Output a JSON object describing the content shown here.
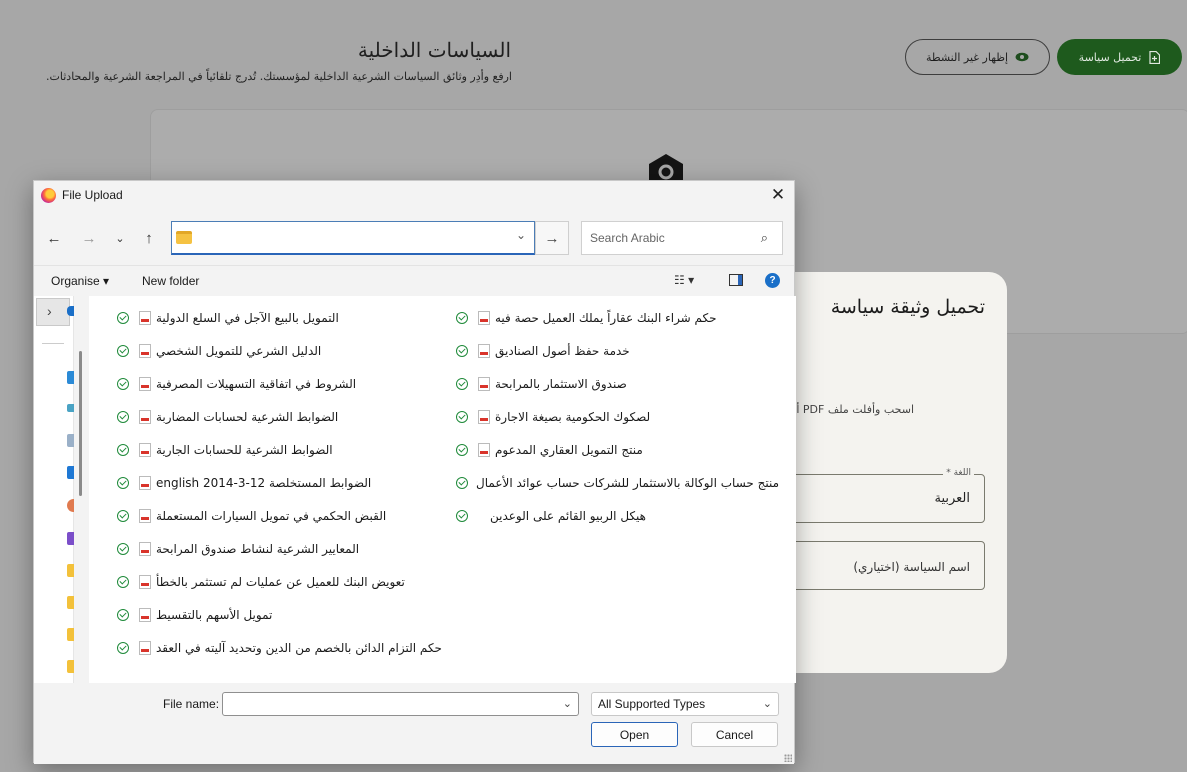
{
  "app": {
    "page_title": "السياسات الداخلية",
    "page_subtitle": "ارفع وأدِر وثائق السياسات الشرعية الداخلية لمؤسستك. تُدرج تلقائياً في المراجعة الشرعية والمحادثات.",
    "show_inactive_label": "إظهار غير النشطة",
    "upload_policy_label": "تحميل سياسة",
    "accent_color": "#1e5a1d"
  },
  "card": {
    "title": "تحميل وثيقة سياسة",
    "drag_hint": "اسحب وأفلت ملف PDF أو",
    "language_label": "اللغة *",
    "language_value": "العربية",
    "policy_name_placeholder": "اسم السياسة (اختياري)"
  },
  "dialog": {
    "title": "File Upload",
    "search_placeholder": "Search Arabic",
    "address_value": "",
    "organise_label": "Organise",
    "new_folder_label": "New folder",
    "file_name_label": "File name:",
    "file_name_value": "",
    "file_type_value": "All Supported Types",
    "open_label": "Open",
    "cancel_label": "Cancel",
    "files_left_column": [
      "التمويل بالبيع الآجل في السلع الدولية",
      "الدليل الشرعي للتمويل الشخصي",
      "الشروط في اتفاقية التسهيلات المصرفية",
      "الضوابط الشرعية لحسابات المضاربة",
      "الضوابط الشرعية للحسابات الجارية",
      "الضوابط المستخلصة 12-3-2014 english",
      "القبض الحكمي في تمويل السيارات المستعملة",
      "المعايير الشرعية لنشاط صندوق المرابحة",
      "تعويض البنك للعميل عن عمليات لم تستثمر بالخطأ",
      "تمويل الأسهم بالتقسيط",
      "حكم التزام الدائن بالخصم من الدين وتحديد آليته في العقد"
    ],
    "files_right_column": [
      "حكم شراء البنك عقاراً يملك العميل حصة فيه",
      "خدمة حفظ أصول الصناديق",
      "صندوق الاستثمار بالمرابحة",
      "لصكوك الحكومية بصيغة الاجارة",
      "منتج التمويل العقاري المدعوم",
      "منتج حساب الوكالة بالاستثمار للشركات حساب عوائد الأعمال",
      "هيكل الربيو القائم على الوعدين"
    ]
  }
}
